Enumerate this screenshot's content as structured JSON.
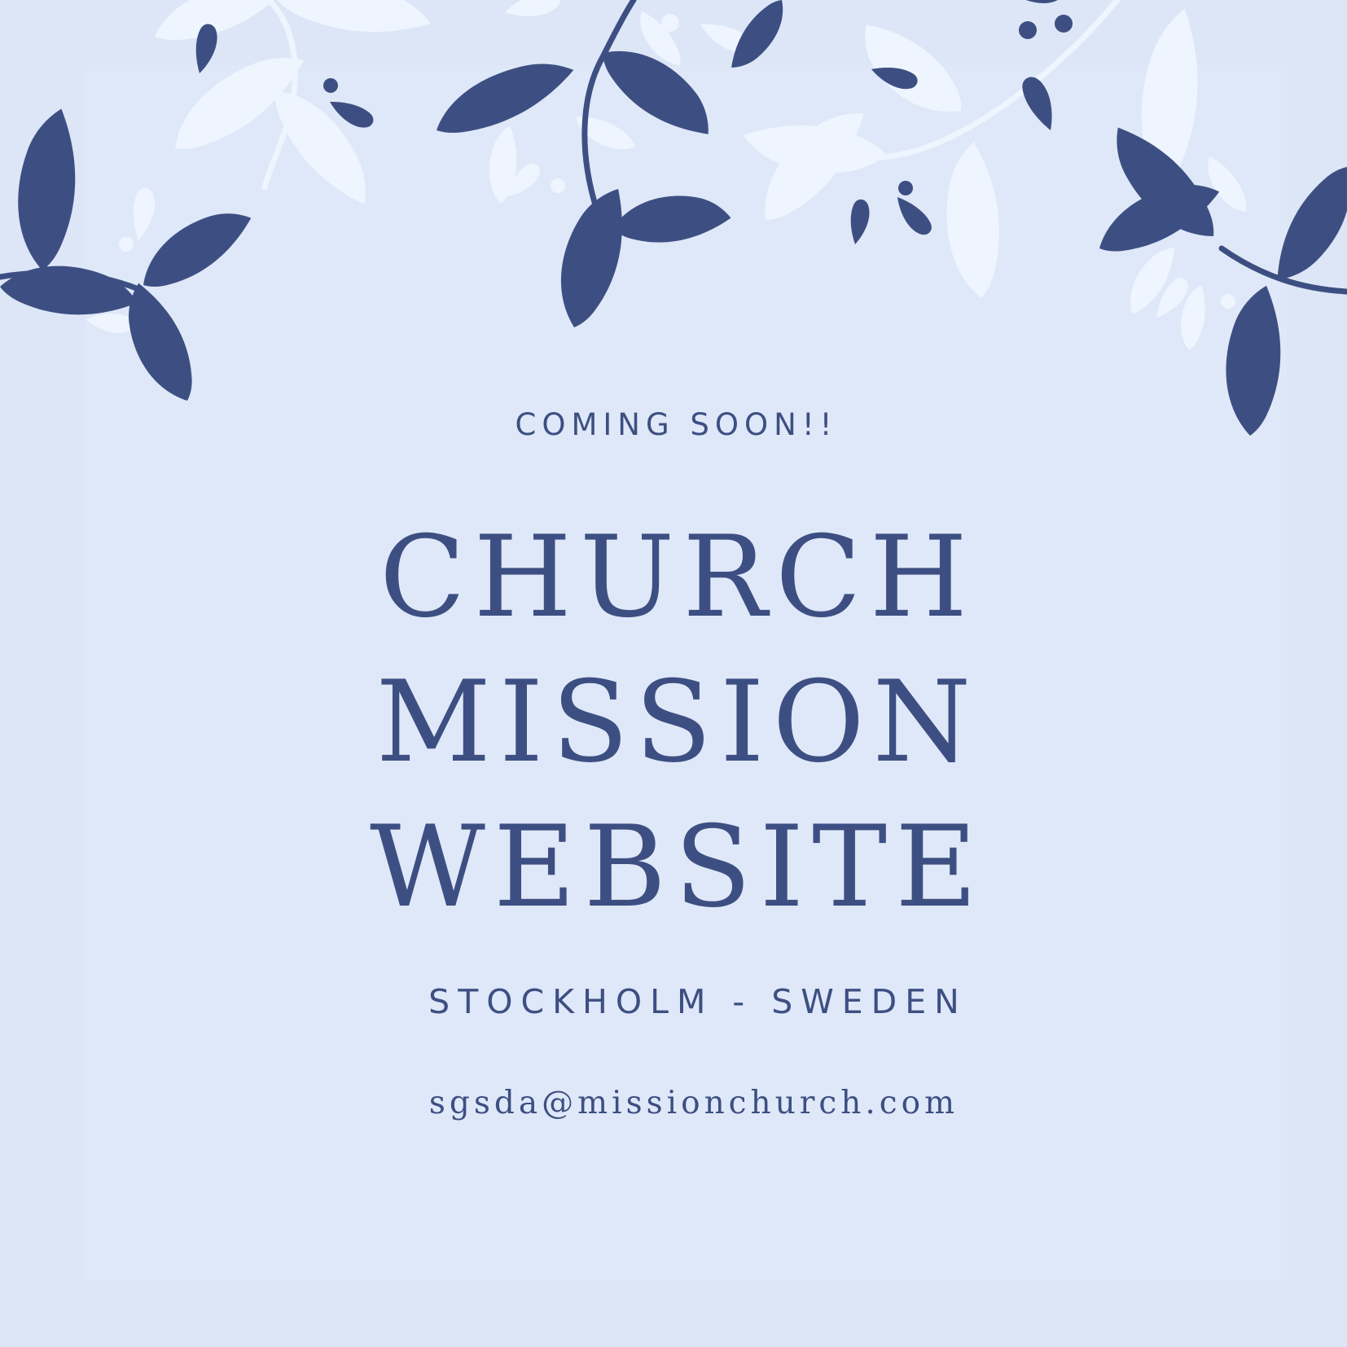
{
  "colors": {
    "background": "#dce6f7",
    "dark_leaf": "#3d4f82",
    "light_leaf": "#eef5ff",
    "text": "#3d4f82"
  },
  "content": {
    "announcement": "COMING SOON!!",
    "title_lines": [
      "CHURCH",
      "MISSION",
      "WEBSITE"
    ],
    "location": "STOCKHOLM - SWEDEN",
    "email": "sgsda@missionchurch.com"
  },
  "decoration": {
    "icon": "leaf-branch-icon"
  }
}
